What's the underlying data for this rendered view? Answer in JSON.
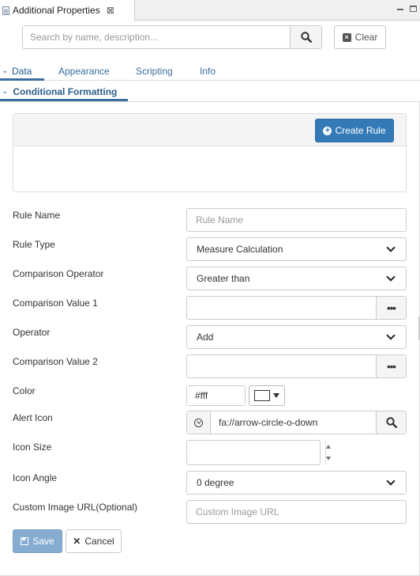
{
  "window": {
    "title": "Additional Properties",
    "close_glyph": "⊠"
  },
  "search": {
    "placeholder": "Search by name, description...",
    "value": "",
    "clear_label": "Clear"
  },
  "tabs": [
    {
      "label": "Data",
      "active": true
    },
    {
      "label": "Appearance",
      "active": false
    },
    {
      "label": "Scripting",
      "active": false
    },
    {
      "label": "Info",
      "active": false
    }
  ],
  "section": {
    "title": "Conditional Formatting",
    "expanded": true
  },
  "rules": {
    "create_label": "Create Rule"
  },
  "form": {
    "rule_name": {
      "label": "Rule Name",
      "placeholder": "Rule Name",
      "value": ""
    },
    "rule_type": {
      "label": "Rule Type",
      "value": "Measure Calculation"
    },
    "comparison_operator": {
      "label": "Comparison Operator",
      "value": "Greater than"
    },
    "comparison_value_1": {
      "label": "Comparison Value 1",
      "value": "",
      "button": "•••"
    },
    "operator": {
      "label": "Operator",
      "value": "Add"
    },
    "comparison_value_2": {
      "label": "Comparison Value 2",
      "value": "",
      "button": "•••"
    },
    "color": {
      "label": "Color",
      "value": "#fff"
    },
    "alert_icon": {
      "label": "Alert Icon",
      "value": "fa://arrow-circle-o-down"
    },
    "icon_size": {
      "label": "Icon Size",
      "value": ""
    },
    "icon_angle": {
      "label": "Icon Angle",
      "value": "0 degree"
    },
    "custom_image_url": {
      "label": "Custom Image URL(Optional)",
      "placeholder": "Custom Image URL",
      "value": ""
    }
  },
  "actions": {
    "save_label": "Save",
    "cancel_label": "Cancel"
  },
  "colors": {
    "accent": "#337ab7",
    "tab_text": "#3a6e9c",
    "save_disabled": "#86acd2"
  }
}
